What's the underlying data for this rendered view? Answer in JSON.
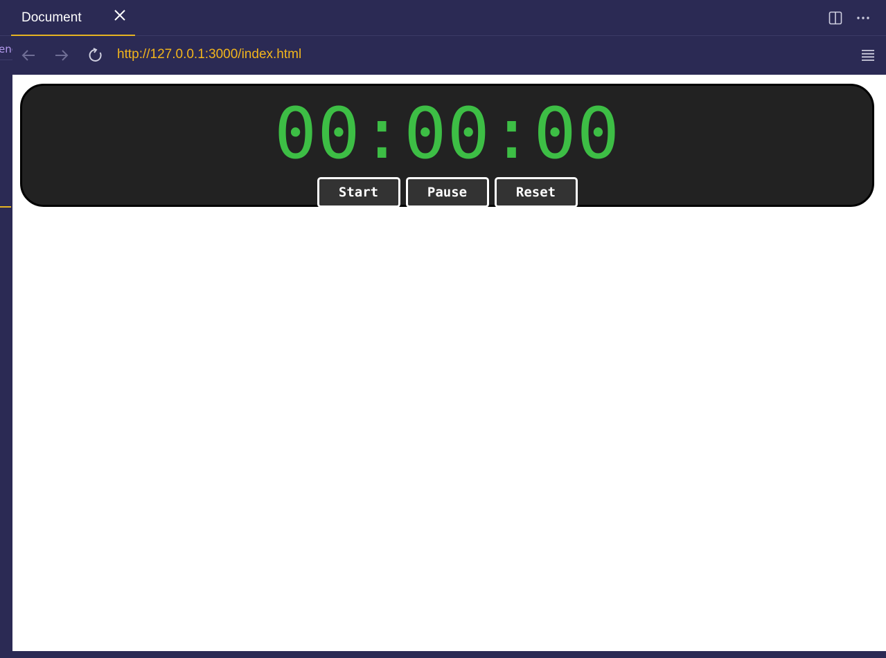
{
  "tab": {
    "title": "Document",
    "close_icon": "close-icon"
  },
  "tabbar_actions": [
    "split-editor-icon",
    "more-actions-icon"
  ],
  "sidebar": {
    "fragment_text": "enc"
  },
  "nav": {
    "back_icon": "arrow-left-icon",
    "forward_icon": "arrow-right-icon",
    "reload_icon": "reload-icon",
    "url": "http://127.0.0.1:3000/index.html",
    "menu_icon": "menu-icon"
  },
  "stopwatch": {
    "display": "00:00:00",
    "buttons": {
      "start": "Start",
      "pause": "Pause",
      "reset": "Reset"
    }
  },
  "colors": {
    "chrome_bg": "#2b2a54",
    "accent": "#e6b422",
    "url_text": "#f2b51c",
    "timer_text": "#3dbe45",
    "panel_bg": "#222222"
  }
}
